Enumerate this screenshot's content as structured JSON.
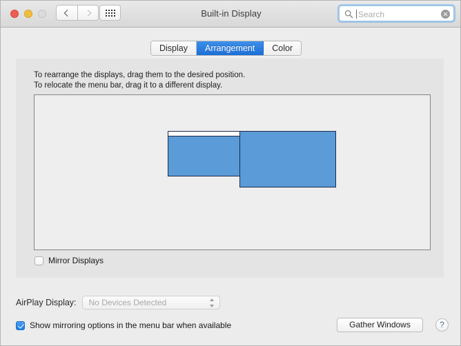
{
  "window": {
    "title": "Built-in Display",
    "traffic_lights": {
      "close": "close-button",
      "minimize": "minimize-button",
      "zoom": "zoom-button"
    },
    "nav": {
      "back": "back-icon",
      "forward": "forward-icon",
      "grid": "grid-view-icon"
    }
  },
  "search": {
    "placeholder": "Search",
    "value": "",
    "icon": "search-icon",
    "clear_icon": "clear-icon"
  },
  "tabs": [
    {
      "label": "Display",
      "selected": false
    },
    {
      "label": "Arrangement",
      "selected": true
    },
    {
      "label": "Color",
      "selected": false
    }
  ],
  "instructions": {
    "line1": "To rearrange the displays, drag them to the desired position.",
    "line2": "To relocate the menu bar, drag it to a different display."
  },
  "arrangement": {
    "displays": [
      {
        "name": "primary-display",
        "has_menu_bar": true
      },
      {
        "name": "secondary-display",
        "has_menu_bar": false
      }
    ],
    "display_color": "#5a9bd8",
    "display_border_color": "#1d2a4a",
    "menu_bar_color": "#ffffff"
  },
  "mirror_displays": {
    "label": "Mirror Displays",
    "checked": false
  },
  "airplay": {
    "label": "AirPlay Display:",
    "value": "No Devices Detected",
    "enabled": false
  },
  "show_mirroring": {
    "label": "Show mirroring options in the menu bar when available",
    "checked": true
  },
  "buttons": {
    "gather_windows": "Gather Windows",
    "help": "?"
  },
  "colors": {
    "accent_blue": "#1d79e4",
    "tab_selected_blue": "#1c6fd6",
    "window_bg": "#ececec",
    "panel_bg": "#e4e4e4"
  }
}
